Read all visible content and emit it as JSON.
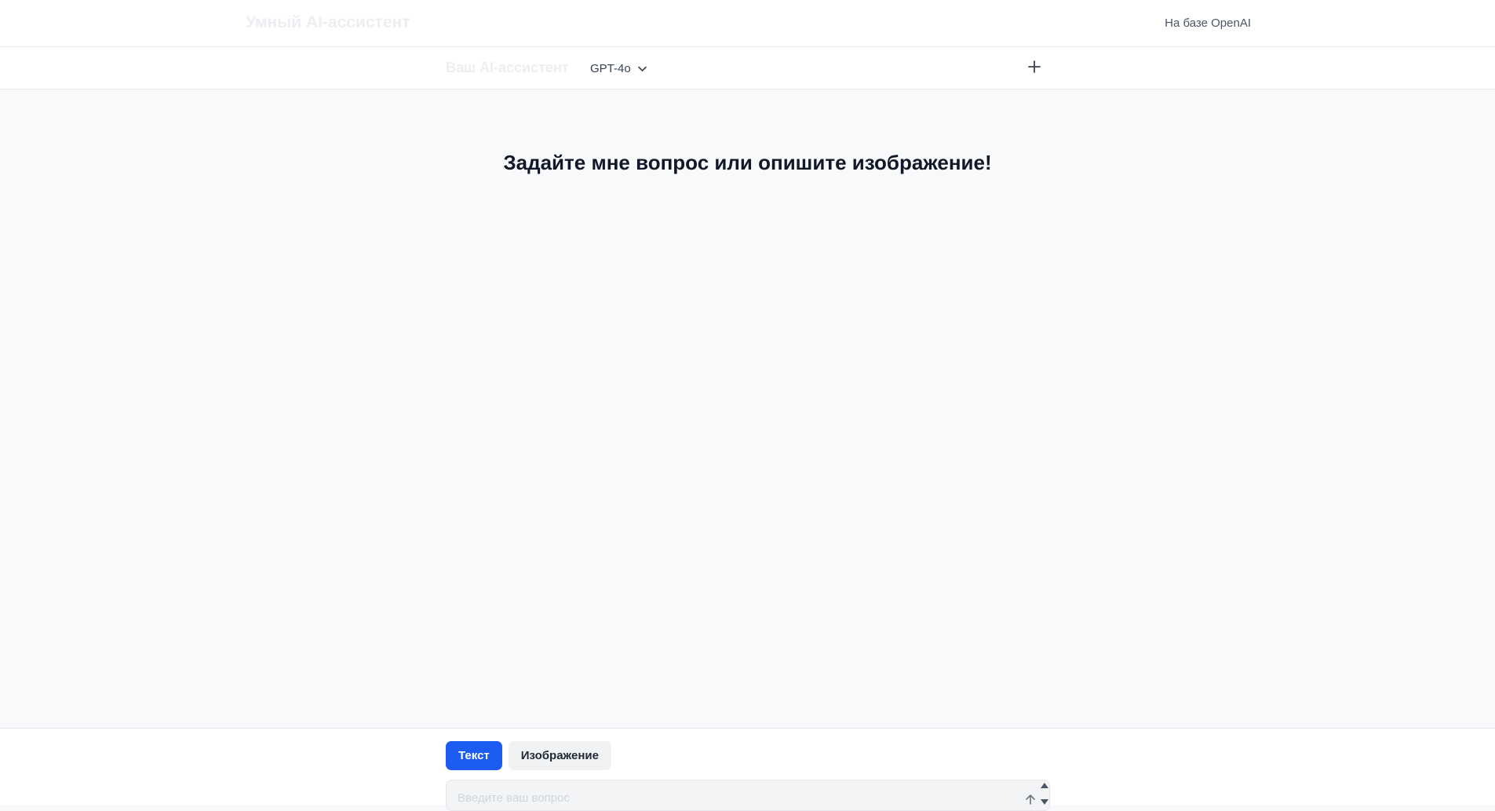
{
  "header": {
    "app_title": "Умный AI-ассистент",
    "powered_by": "На базе OpenAI"
  },
  "subheader": {
    "assistant_title": "Ваш AI-ассистент",
    "model": "GPT-4o",
    "new_chat_icon": "plus-icon"
  },
  "main": {
    "welcome": "Задайте мне вопрос или опишите изображение!"
  },
  "composer": {
    "tabs": [
      {
        "label": "Текст",
        "active": true
      },
      {
        "label": "Изображение",
        "active": false
      }
    ],
    "placeholder": "Введите ваш вопрос",
    "value": "",
    "send_icon": "arrow-up-icon"
  },
  "colors": {
    "accent": "#1d5cf0",
    "background": "#f8f9fb"
  }
}
